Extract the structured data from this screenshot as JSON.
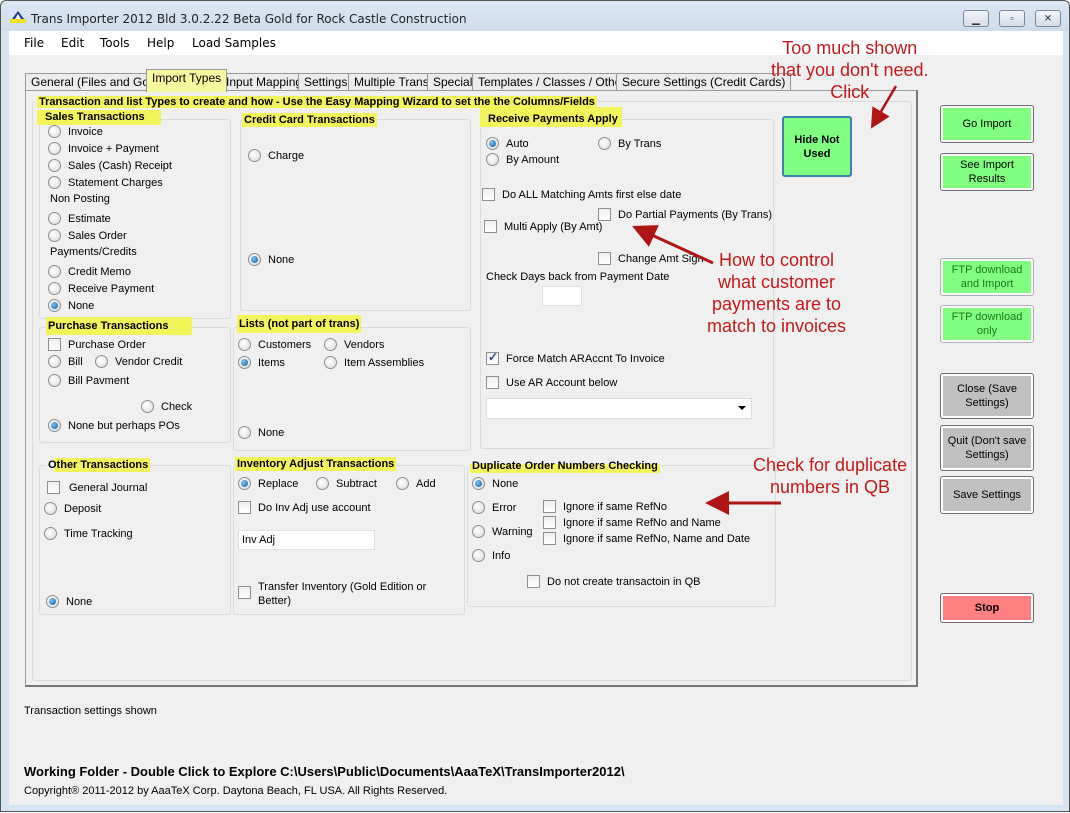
{
  "window": {
    "title": "Trans Importer 2012 Bld 3.0.2.22 Beta Gold  for Rock Castle Construction",
    "controls": {
      "minimize": "▭",
      "maximize": "□",
      "close": "✕"
    }
  },
  "menu": [
    "File",
    "Edit",
    "Tools",
    "Help",
    "Load Samples"
  ],
  "tabs": [
    {
      "label": "General (Files and Go)",
      "active": false
    },
    {
      "label": "Import Types",
      "active": true
    },
    {
      "label": "Input Mapping",
      "active": false
    },
    {
      "label": "Settings",
      "active": false
    },
    {
      "label": "Multiple Trans",
      "active": false
    },
    {
      "label": "Special",
      "active": false
    },
    {
      "label": "Templates / Classes / Other",
      "active": false
    },
    {
      "label": "Secure Settings (Credit Cards)",
      "active": false
    }
  ],
  "panel": {
    "heading": "Transaction and list Types to create and how -  Use the Easy Mapping Wizard to set the the Columns/Fields",
    "sales": {
      "title": "Sales Transactions",
      "options": [
        "Invoice",
        "Invoice + Payment",
        "Sales (Cash) Receipt",
        "Statement Charges"
      ],
      "non_posting_label": "Non Posting",
      "non_posting_options": [
        "Estimate",
        "Sales Order"
      ],
      "payments_label": "Payments/Credits",
      "payments_options": [
        "Credit Memo",
        "Receive Payment",
        "None"
      ],
      "selected": "None"
    },
    "credit_card": {
      "title": "Credit Card Transactions",
      "options": [
        "Charge",
        "None"
      ],
      "selected": "None"
    },
    "receive_payments": {
      "title": "Receive Payments Apply",
      "auto": "Auto",
      "by_trans": "By Trans",
      "by_amount": "By Amount",
      "selected": "Auto",
      "do_all_matching": {
        "label": "Do ALL Matching Amts first else date",
        "checked": false
      },
      "do_partial": {
        "label": "Do Partial Payments (By Trans)",
        "checked": false
      },
      "multi_apply": {
        "label": "Multi Apply (By Amt)",
        "checked": false
      },
      "change_amt_sign": {
        "label": "Change Amt Sign",
        "checked": false
      },
      "check_days_label": "Check Days back from Payment Date",
      "check_days_value": "",
      "force_match": {
        "label": "Force Match ARAccnt To Invoice",
        "checked": true
      },
      "use_ar_account": {
        "label": "Use AR Account below",
        "checked": false
      },
      "ar_account_value": ""
    },
    "hide_not_used": "Hide Not Used",
    "purchase": {
      "title": "Purchase Transactions",
      "purchase_order": {
        "label": "Purchase Order",
        "checked": false
      },
      "bill": "Bill",
      "vendor_credit": "Vendor Credit",
      "bill_payment": "Bill Pavment",
      "check": "Check",
      "none": "None but perhaps POs",
      "selected": "None but perhaps POs"
    },
    "lists": {
      "title": "Lists (not part of trans)",
      "customers": "Customers",
      "vendors": "Vendors",
      "items": "Items",
      "item_assemblies": "Item Assemblies",
      "none": "None",
      "selected": "Items"
    },
    "other": {
      "title": "Other Transactions",
      "general_journal": {
        "label": "General Journal",
        "checked": false
      },
      "deposit": "Deposit",
      "time_tracking": "Time Tracking",
      "none": "None",
      "selected": "None"
    },
    "inventory": {
      "title": "Inventory Adjust Transactions",
      "replace": "Replace",
      "subtract": "Subtract",
      "add": "Add",
      "selected": "Replace",
      "do_inv_adj": {
        "label": "Do Inv Adj  use account",
        "checked": false
      },
      "account_value": "Inv Adj",
      "transfer": {
        "label": "Transfer Inventory (Gold Edition or Better)",
        "checked": false
      }
    },
    "duplicate": {
      "title": "Duplicate Order Numbers Checking",
      "none": "None",
      "error": "Error",
      "warning": "Warning",
      "info": "Info",
      "selected": "None",
      "ignore_refno": {
        "label": "Ignore if same RefNo",
        "checked": false
      },
      "ignore_refno_name": {
        "label": "Ignore if same RefNo and Name",
        "checked": false
      },
      "ignore_refno_name_date": {
        "label": "Ignore if same RefNo, Name and Date",
        "checked": false
      },
      "do_not_create": {
        "label": "Do not create transactoin in QB",
        "checked": false
      }
    }
  },
  "side_buttons": {
    "go_import": "Go Import",
    "see_results": "See Import Results",
    "ftp_import": "FTP download and Import",
    "ftp_only": "FTP download only",
    "close_save": "Close (Save Settings)",
    "quit": "Quit (Don't save Settings)",
    "save": "Save Settings",
    "stop": "Stop"
  },
  "annotations": {
    "too_much": "Too much shown\nthat you don't need.\nClick",
    "how_to_control": "How to control\nwhat customer\npayments are to\nmatch to invoices",
    "check_dup": "Check for duplicate\nnumbers in QB"
  },
  "footer": {
    "status": "Transaction settings shown",
    "working_folder": "Working Folder - Double Click to Explore C:\\Users\\Public\\Documents\\AaaTeX\\TransImporter2012\\",
    "copyright": "Copyright® 2011-2012 by AaaTeX Corp. Daytona Beach, FL USA. All Rights Reserved."
  },
  "colors": {
    "highlight": "#f3f35a",
    "green_button": "#80ff80",
    "gray_button": "#c0c0c0",
    "red_button": "#ff8080",
    "annotation": "#c41a1a"
  }
}
